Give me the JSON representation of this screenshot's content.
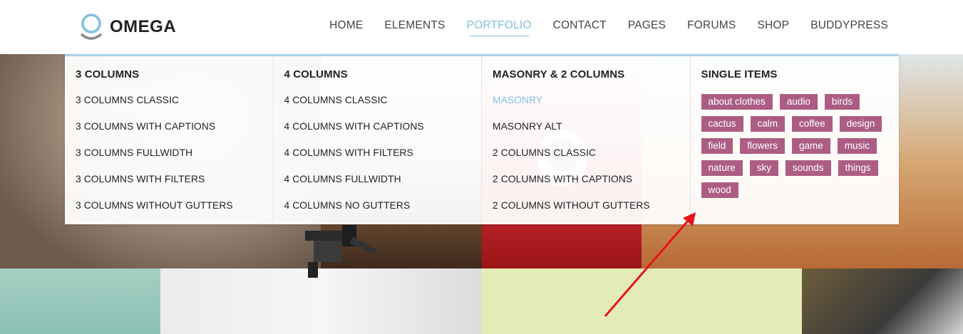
{
  "brand": {
    "name": "OMEGA",
    "logo_icon": "ring-logo-icon"
  },
  "nav": {
    "items": [
      {
        "label": "HOME"
      },
      {
        "label": "ELEMENTS"
      },
      {
        "label": "PORTFOLIO",
        "active": true
      },
      {
        "label": "CONTACT"
      },
      {
        "label": "PAGES"
      },
      {
        "label": "FORUMS"
      },
      {
        "label": "SHOP"
      },
      {
        "label": "BUDDYPRESS"
      }
    ]
  },
  "menu": {
    "columns": [
      {
        "title": "3 COLUMNS",
        "links": [
          "3 COLUMNS CLASSIC",
          "3 COLUMNS WITH CAPTIONS",
          "3 COLUMNS FULLWIDTH",
          "3 COLUMNS WITH FILTERS",
          "3 COLUMNS WITHOUT GUTTERS"
        ]
      },
      {
        "title": "4 COLUMNS",
        "links": [
          "4 COLUMNS CLASSIC",
          "4 COLUMNS WITH CAPTIONS",
          "4 COLUMNS WITH FILTERS",
          "4 COLUMNS FULLWIDTH",
          "4 COLUMNS NO GUTTERS"
        ]
      },
      {
        "title": "MASONRY & 2 COLUMNS",
        "links": [
          "MASONRY",
          "MASONRY ALT",
          "2 COLUMNS CLASSIC",
          "2 COLUMNS WITH CAPTIONS",
          "2 COLUMNS WITHOUT GUTTERS"
        ],
        "active_link": "MASONRY"
      },
      {
        "title": "SINGLE ITEMS",
        "tags": [
          "about clothes",
          "audio",
          "birds",
          "cactus",
          "calm",
          "coffee",
          "design",
          "field",
          "flowers",
          "game",
          "music",
          "nature",
          "sky",
          "sounds",
          "things",
          "wood"
        ]
      }
    ]
  },
  "colors": {
    "accent": "#7fbfe0",
    "tag": "#ac5d84",
    "menu_border": "#a7d1ea",
    "annotation_arrow": "#e8141a"
  }
}
